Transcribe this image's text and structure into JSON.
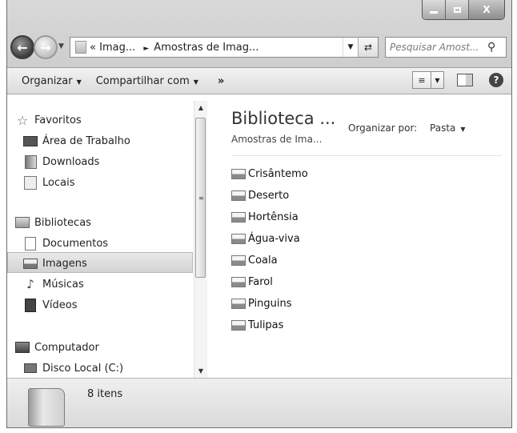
{
  "window": {
    "caption": {
      "minimize_icon": "minimize-icon",
      "maximize_icon": "maximize-icon",
      "close_label": "X"
    }
  },
  "nav": {
    "back_icon": "back-arrow-icon",
    "forward_icon": "forward-arrow-icon",
    "address": {
      "prefix": "«",
      "crumb1": "Imag...",
      "crumb2": "Amostras de Imag..."
    },
    "refresh_icon": "refresh-icon",
    "search": {
      "placeholder": "Pesquisar Amost...",
      "icon": "search-icon"
    }
  },
  "toolbar": {
    "organize_label": "Organizar",
    "share_label": "Compartilhar com",
    "more_label": "»",
    "help_label": "?"
  },
  "sidebar": {
    "favorites": {
      "label": "Favoritos",
      "items": [
        {
          "label": "Área de Trabalho"
        },
        {
          "label": "Downloads"
        },
        {
          "label": "Locais"
        }
      ]
    },
    "libraries": {
      "label": "Bibliotecas",
      "items": [
        {
          "label": "Documentos"
        },
        {
          "label": "Imagens"
        },
        {
          "label": "Músicas"
        },
        {
          "label": "Vídeos"
        }
      ],
      "selected": "Imagens"
    },
    "computer": {
      "label": "Computador",
      "partial": "Disco Local (C:)"
    }
  },
  "main": {
    "title": "Biblioteca ...",
    "subtitle": "Amostras de Ima...",
    "arrange_label": "Organizar por:",
    "arrange_value": "Pasta",
    "files": [
      {
        "name": "Crisântemo"
      },
      {
        "name": "Deserto"
      },
      {
        "name": "Hortênsia"
      },
      {
        "name": "Água-viva"
      },
      {
        "name": "Coala"
      },
      {
        "name": "Farol"
      },
      {
        "name": "Pinguins"
      },
      {
        "name": "Tulipas"
      }
    ]
  },
  "status": {
    "count": "8 itens"
  }
}
